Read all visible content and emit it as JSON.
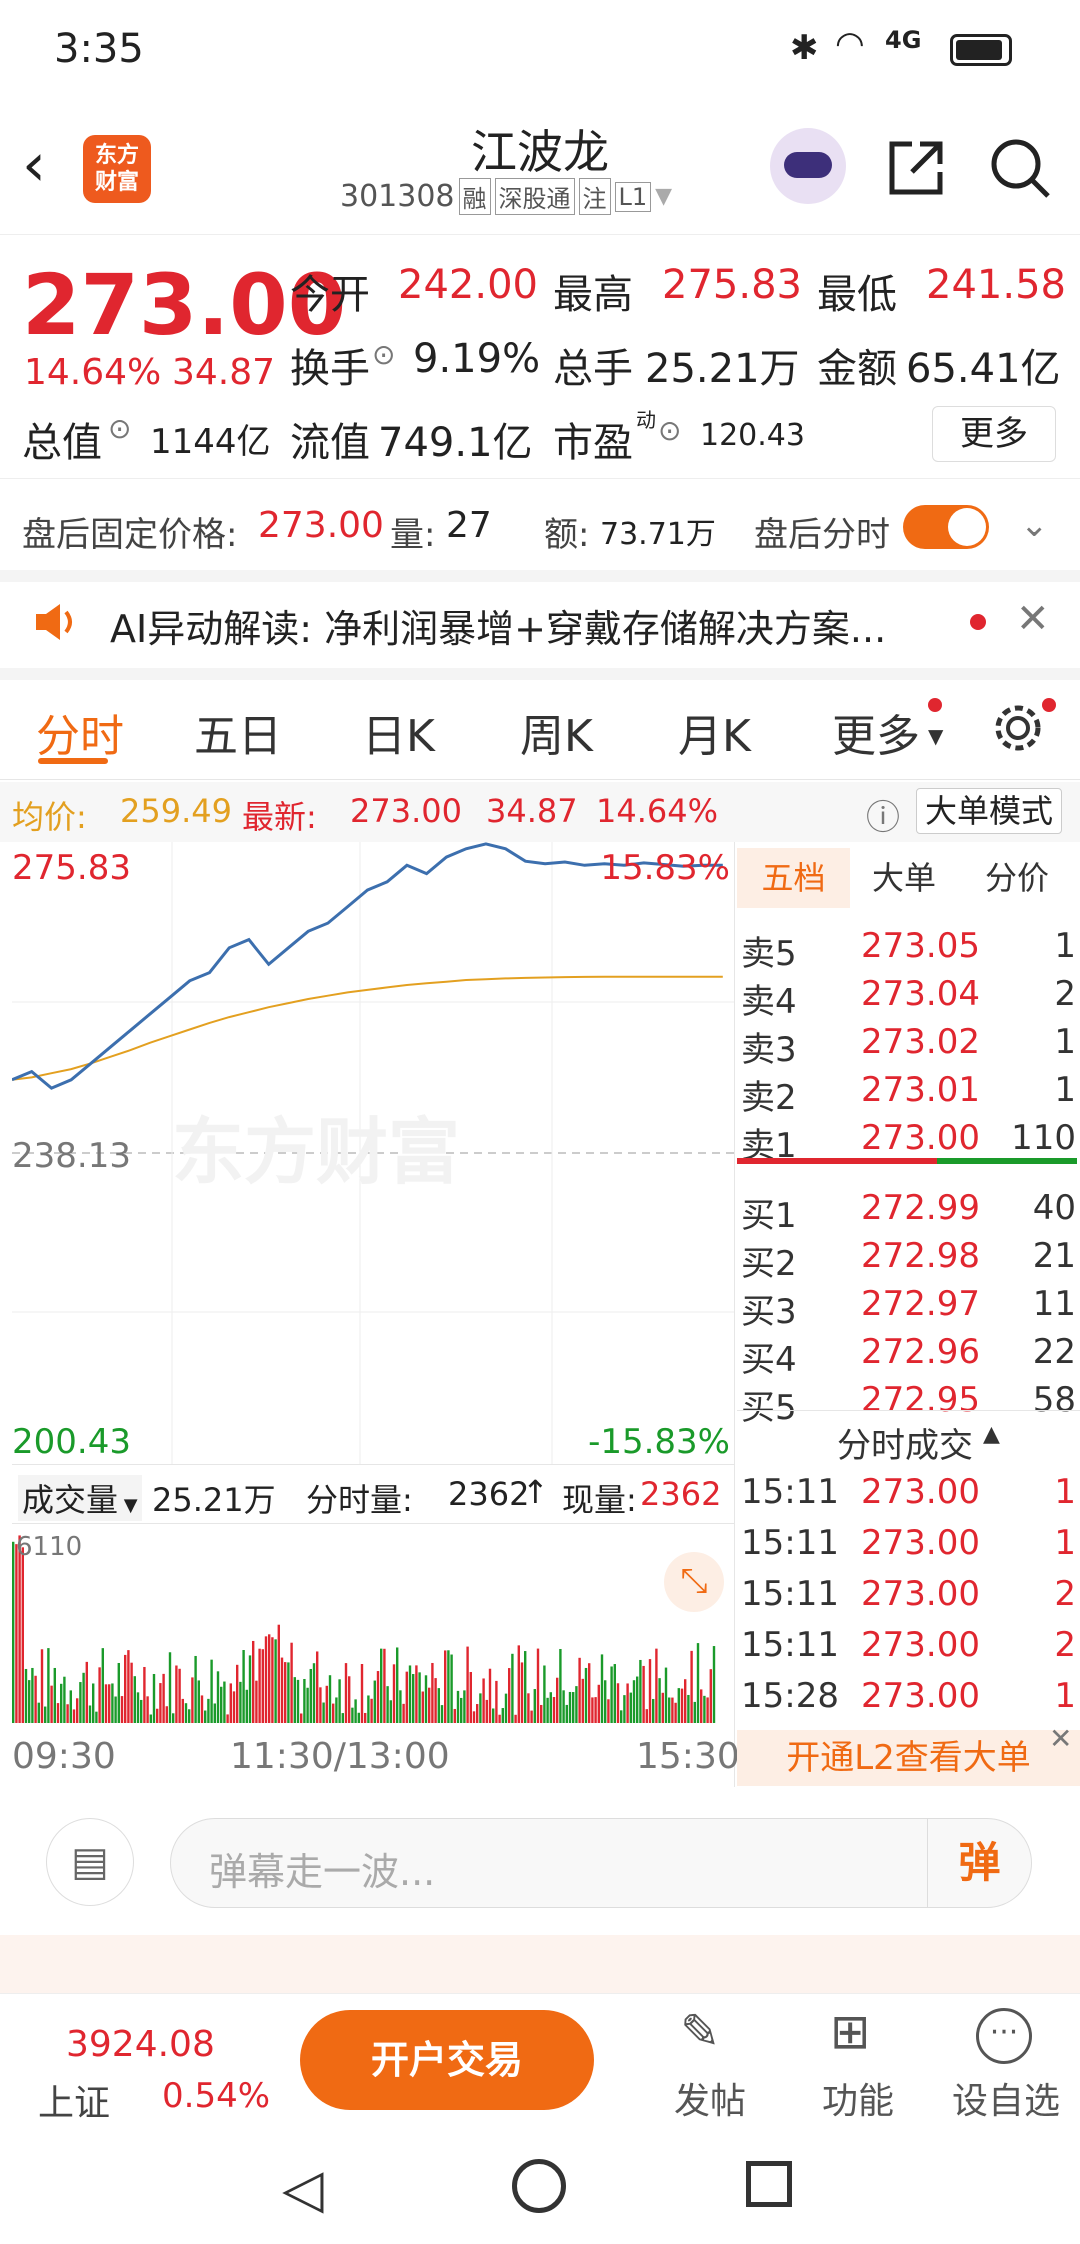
{
  "status": {
    "time": "3:35",
    "network": "4G"
  },
  "nav": {
    "title": "江波龙",
    "code": "301308",
    "tags": [
      "融",
      "深股通",
      "注",
      "L1"
    ],
    "logo": "东方\n财富"
  },
  "quote": {
    "price": "273.00",
    "change_pct": "14.64%",
    "change": "34.87",
    "open_label": "今开",
    "open": "242.00",
    "high_label": "最高",
    "high": "275.83",
    "low_label": "最低",
    "low": "241.58",
    "turnover_label": "换手",
    "turnover": "9.19%",
    "vol_label": "总手",
    "vol": "25.21万",
    "amount_label": "金额",
    "amount": "65.41亿",
    "mcap_label": "总值",
    "mcap": "1144亿",
    "float_label": "流值",
    "float": "749.1亿",
    "pe_label": "市盈",
    "pe_sup": "动",
    "pe": "120.43",
    "more": "更多"
  },
  "after": {
    "fixed_label": "盘后固定价格:",
    "fixed_price": "273.00",
    "vol_label": "量:",
    "vol": "27",
    "amt_label": "额:",
    "amt": "73.71万",
    "toggle_label": "盘后分时"
  },
  "ai": {
    "text": "AI异动解读:  净利润暴增+穿戴存储解决方案..."
  },
  "tabs": {
    "items": [
      "分时",
      "五日",
      "日K",
      "周K",
      "月K",
      "更多"
    ]
  },
  "info": {
    "avg_label": "均价:",
    "avg": "259.49",
    "latest_label": "最新:",
    "latest": "273.00",
    "chg": "34.87",
    "pct": "14.64%",
    "mode": "大单模式"
  },
  "chart": {
    "top": "275.83",
    "top_pct": "15.83%",
    "mid": "238.13",
    "bottom": "200.43",
    "bottom_pct": "-15.83%",
    "watermark": "东方财富",
    "vol_label": "成交量",
    "vol_total": "25.21万",
    "min_vol_label": "分时量:",
    "min_vol": "2362",
    "cur_vol_label": "现量:",
    "cur_vol": "2362",
    "vol_max": "6110",
    "times": [
      "09:30",
      "11:30/13:00",
      "15:30"
    ]
  },
  "chart_data": {
    "type": "line",
    "series": [
      {
        "values": [
          247,
          248,
          246,
          247,
          249,
          251,
          253,
          255,
          257,
          259,
          260,
          263,
          264,
          261,
          263,
          265,
          266,
          268,
          270,
          271,
          273,
          272,
          274,
          275,
          275.6,
          275,
          273.5,
          273.2,
          273.4,
          273,
          273.2,
          273,
          273.3,
          273.1,
          272.9,
          273,
          273
        ]
      },
      {
        "values": [
          247,
          247.3,
          247.8,
          248.3,
          249,
          249.8,
          250.6,
          251.5,
          252.3,
          253.1,
          253.9,
          254.6,
          255.2,
          255.8,
          256.3,
          256.8,
          257.2,
          257.6,
          257.9,
          258.2,
          258.5,
          258.7,
          258.9,
          259.1,
          259.2,
          259.3,
          259.35,
          259.4,
          259.45,
          259.48,
          259.49,
          259.49,
          259.49,
          259.49,
          259.49,
          259.49,
          259.49
        ]
      }
    ],
    "ylim": [
      200.43,
      275.83
    ]
  },
  "book": {
    "tabs": [
      "五档",
      "大单",
      "分价"
    ],
    "sells": [
      [
        "卖5",
        "273.05",
        "1"
      ],
      [
        "卖4",
        "273.04",
        "2"
      ],
      [
        "卖3",
        "273.02",
        "1"
      ],
      [
        "卖2",
        "273.01",
        "1"
      ],
      [
        "卖1",
        "273.00",
        "110"
      ]
    ],
    "buys": [
      [
        "买1",
        "272.99",
        "40"
      ],
      [
        "买2",
        "272.98",
        "21"
      ],
      [
        "买3",
        "272.97",
        "11"
      ],
      [
        "买4",
        "272.96",
        "22"
      ],
      [
        "买5",
        "272.95",
        "58"
      ]
    ],
    "trades_title": "分时成交",
    "trades": [
      [
        "15:11",
        "273.00",
        "1"
      ],
      [
        "15:11",
        "273.00",
        "1"
      ],
      [
        "15:11",
        "273.00",
        "2"
      ],
      [
        "15:11",
        "273.00",
        "2"
      ],
      [
        "15:28",
        "273.00",
        "1"
      ]
    ],
    "l2": "开通L2查看大单"
  },
  "comment": {
    "placeholder": "弹幕走一波...",
    "btn": "弹"
  },
  "bar": {
    "index_value": "3924.08",
    "index_name": "上证",
    "index_pct": "0.54%",
    "trade_btn": "开户交易",
    "post": "发帖",
    "func": "功能",
    "fav": "设自选"
  },
  "colors": {
    "up": "#e0262f",
    "down": "#1a9a2a",
    "accent": "#f06a13",
    "line": "#3c6fae",
    "avg": "#e3a020"
  }
}
